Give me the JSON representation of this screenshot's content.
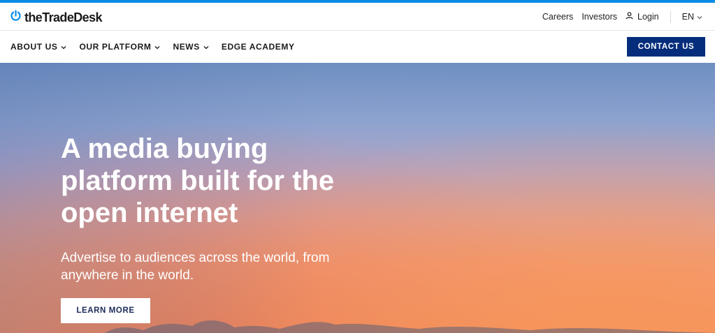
{
  "brand": {
    "logo_text": "theTradeDesk",
    "accent_color": "#0b8be6",
    "navy": "#062d7c"
  },
  "utility_nav": {
    "careers": "Careers",
    "investors": "Investors",
    "login": "Login",
    "language": "EN"
  },
  "main_nav": {
    "items": [
      {
        "label": "ABOUT US",
        "has_dropdown": true
      },
      {
        "label": "OUR PLATFORM",
        "has_dropdown": true
      },
      {
        "label": "NEWS",
        "has_dropdown": true
      },
      {
        "label": "EDGE ACADEMY",
        "has_dropdown": false
      }
    ],
    "contact_label": "CONTACT US"
  },
  "hero": {
    "title_lines": [
      "A media buying",
      "platform built for the",
      "open internet"
    ],
    "subtitle_lines": [
      "Advertise to audiences across the world, from",
      "anywhere in the world."
    ],
    "cta_label": "LEARN MORE"
  },
  "icons": [
    "power-logo-icon",
    "user-icon",
    "chevron-down-icon"
  ]
}
